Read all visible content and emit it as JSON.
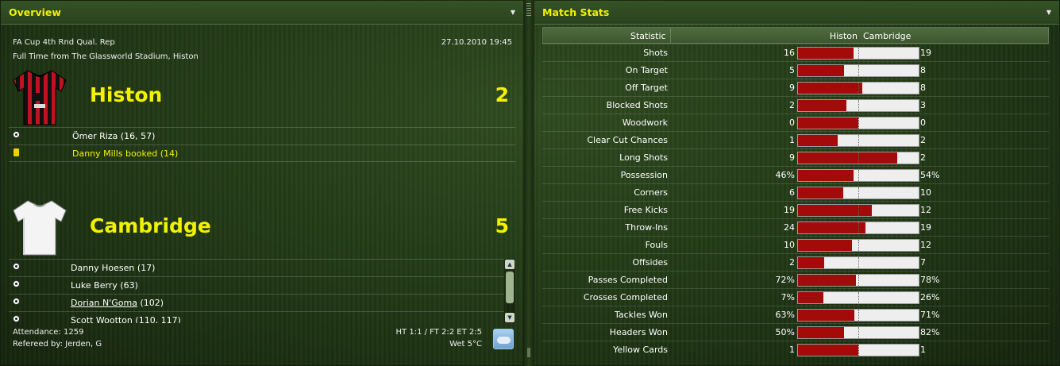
{
  "overview": {
    "title": "Overview",
    "competition": "FA Cup 4th Rnd Qual. Rep",
    "datetime": "27.10.2010 19:45",
    "venue": "Full Time from The Glassworld Stadium, Histon",
    "home": {
      "name": "Histon",
      "score": "2",
      "events": [
        {
          "icon": "ball-icon",
          "text": "Ömer Riza (16, 57)",
          "type": "goal"
        },
        {
          "icon": "yellow-card-icon",
          "text": "Danny Mills booked (14)",
          "type": "booking"
        }
      ]
    },
    "away": {
      "name": "Cambridge",
      "score": "5",
      "events": [
        {
          "icon": "ball-icon",
          "text": "Danny Hoesen (17)",
          "type": "goal"
        },
        {
          "icon": "ball-icon",
          "text": "Luke Berry (63)",
          "type": "goal"
        },
        {
          "icon": "ball-icon",
          "text_link": "Dorian N'Goma",
          "text_rest": " (102)",
          "type": "goal"
        },
        {
          "icon": "ball-icon",
          "text": "Scott Wootton (110, 117)",
          "type": "goal"
        }
      ]
    },
    "attendance": "Attendance: 1259",
    "referee": "Refereed by: Jerden, G",
    "scores_summary": "HT 1:1 / FT 2:2 ET 2:5",
    "weather": "Wet 5°C"
  },
  "match_stats": {
    "title": "Match Stats",
    "headers": {
      "statistic": "Statistic",
      "home": "Histon",
      "away": "Cambridge"
    },
    "colors": {
      "home_bar": "#a30a0a",
      "away_bar": "#eeeeee",
      "title": "#f2f200"
    },
    "rows": [
      {
        "label": "Shots",
        "home": "16",
        "away": "19",
        "home_share": 0.46
      },
      {
        "label": "On Target",
        "home": "5",
        "away": "8",
        "home_share": 0.38
      },
      {
        "label": "Off Target",
        "home": "9",
        "away": "8",
        "home_share": 0.53
      },
      {
        "label": "Blocked Shots",
        "home": "2",
        "away": "3",
        "home_share": 0.4
      },
      {
        "label": "Woodwork",
        "home": "0",
        "away": "0",
        "home_share": 0.5
      },
      {
        "label": "Clear Cut Chances",
        "home": "1",
        "away": "2",
        "home_share": 0.33
      },
      {
        "label": "Long Shots",
        "home": "9",
        "away": "2",
        "home_share": 0.82
      },
      {
        "label": "Possession",
        "home": "46%",
        "away": "54%",
        "home_share": 0.46
      },
      {
        "label": "Corners",
        "home": "6",
        "away": "10",
        "home_share": 0.375
      },
      {
        "label": "Free Kicks",
        "home": "19",
        "away": "12",
        "home_share": 0.61
      },
      {
        "label": "Throw-Ins",
        "home": "24",
        "away": "19",
        "home_share": 0.56
      },
      {
        "label": "Fouls",
        "home": "10",
        "away": "12",
        "home_share": 0.45
      },
      {
        "label": "Offsides",
        "home": "2",
        "away": "7",
        "home_share": 0.22
      },
      {
        "label": "Passes Completed",
        "home": "72%",
        "away": "78%",
        "home_share": 0.48
      },
      {
        "label": "Crosses Completed",
        "home": "7%",
        "away": "26%",
        "home_share": 0.21
      },
      {
        "label": "Tackles Won",
        "home": "63%",
        "away": "71%",
        "home_share": 0.47
      },
      {
        "label": "Headers Won",
        "home": "50%",
        "away": "82%",
        "home_share": 0.38
      },
      {
        "label": "Yellow Cards",
        "home": "1",
        "away": "1",
        "home_share": 0.5
      }
    ]
  }
}
